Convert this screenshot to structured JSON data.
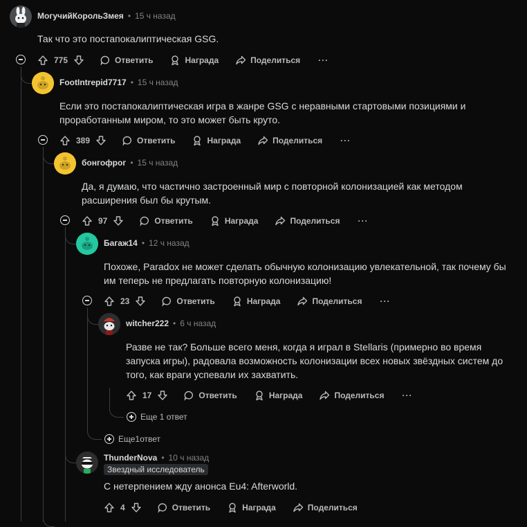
{
  "comments": [
    {
      "user": "МогучийКорольЗмея",
      "time": "15 ч назад",
      "text": "Так что это постапокалиптическая GSG.",
      "votes": "775",
      "avatar": "mascot-white-bunny"
    },
    {
      "user": "FootIntrepid7717",
      "time": "15 ч назад",
      "text_lines": [
        "Если это постапокалиптическая игра в жанре GSG с неравными стартовыми позициями и",
        "проработанным миром, то это может быть круто."
      ],
      "votes": "389",
      "avatar": "snoo-yellow"
    },
    {
      "user": "бонгофрог",
      "time": "15 ч назад",
      "text_lines": [
        "Да, я думаю, что частично застроенный мир с повторной колонизацией как методом",
        "расширения был бы крутым."
      ],
      "votes": "97",
      "avatar": "snoo-yellow"
    },
    {
      "user": "Багаж14",
      "time": "12 ч назад",
      "text_lines": [
        "Похоже, Paradox не может сделать обычную колонизацию увлекательной, так почему бы",
        "им теперь не предлагать повторную колонизацию!"
      ],
      "votes": "23",
      "avatar": "snoo-teal"
    },
    {
      "user": "witcher222",
      "time": "6 ч назад",
      "text_lines": [
        "Разве не так? Больше всего меня, когда я играл в Stellaris (примерно во время",
        "запуска игры), радовала возможность колонизации всех новых звёздных систем до",
        "того, как враги успевали их захватить."
      ],
      "votes": "17",
      "avatar": "snoo-dark-red"
    },
    {
      "user": "ThunderNova",
      "time": "10 ч назад",
      "flair": "Звездный исследователь",
      "text": "С нетерпением жду анонса Eu4: Afterworld.",
      "votes": "4",
      "avatar": "snoo-sunglasses-green"
    }
  ],
  "labels": {
    "separator": "•",
    "reply": "Ответить",
    "award": "Награда",
    "share": "Поделиться",
    "more": "···",
    "more_reply_1": "Еще 1 ответ",
    "more_reply_2": "Еще1ответ"
  },
  "colors": {
    "background": "#0b0b0b",
    "text": "#d7dadc",
    "muted": "#818384",
    "thread_line": "#3a3d40"
  }
}
